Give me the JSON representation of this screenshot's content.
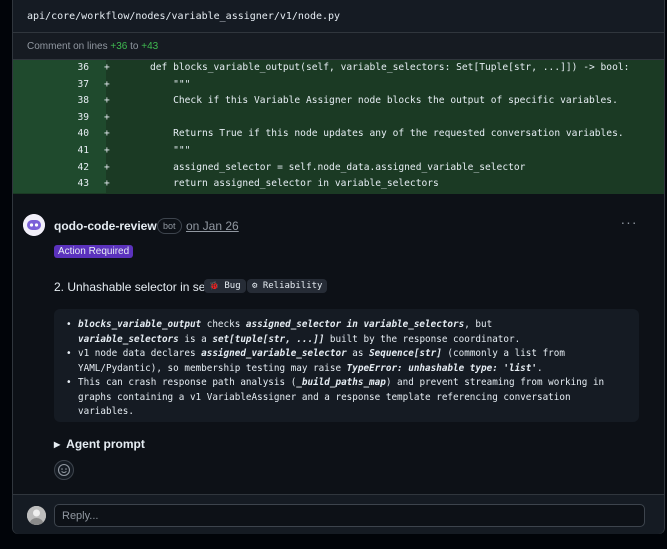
{
  "file": {
    "path": "api/core/workflow/nodes/variable_assigner/v1/node.py"
  },
  "comment_lines": {
    "prefix": "Comment on lines",
    "from": "+36",
    "sep": "to",
    "to": "+43"
  },
  "diff": [
    {
      "num": "36",
      "sign": "+",
      "code": "def blocks_variable_output(self, variable_selectors: Set[Tuple[str, ...]]) -> bool:"
    },
    {
      "num": "37",
      "sign": "+",
      "code": "    \"\"\""
    },
    {
      "num": "38",
      "sign": "+",
      "code": "    Check if this Variable Assigner node blocks the output of specific variables."
    },
    {
      "num": "39",
      "sign": "+",
      "code": ""
    },
    {
      "num": "40",
      "sign": "+",
      "code": "    Returns True if this node updates any of the requested conversation variables."
    },
    {
      "num": "41",
      "sign": "+",
      "code": "    \"\"\""
    },
    {
      "num": "42",
      "sign": "+",
      "code": "    assigned_selector = self.node_data.assigned_variable_selector"
    },
    {
      "num": "43",
      "sign": "+",
      "code": "    return assigned_selector in variable_selectors"
    }
  ],
  "comment": {
    "author": "qodo-code-review",
    "bot_badge": "bot",
    "date": "on Jan 26",
    "more_icon": "kebab-horizontal-icon",
    "action_badge": "Action Required",
    "issue_title": "2. Unhashable selector in set",
    "tags": [
      {
        "icon": "bug-icon",
        "glyph": "🐞",
        "label": "Bug"
      },
      {
        "icon": "gear-icon",
        "glyph": "⚙",
        "label": "Reliability"
      }
    ],
    "bullets": {
      "b1_p1": "blocks_variable_output",
      "b1_p2": " checks ",
      "b1_p3": "assigned_selector in variable_selectors",
      "b1_p4": ", but ",
      "b1_p5": "variable_selectors",
      "b1_p6": " is a ",
      "b1_p7": "set[tuple[str, ...]]",
      "b1_p8": " built by the response coordinator.",
      "b2_p1": "v1 node data declares ",
      "b2_p2": "assigned_variable_selector",
      "b2_p3": " as ",
      "b2_p4": "Sequence[str]",
      "b2_p5": " (commonly a list from YAML/Pydantic), so membership testing may raise ",
      "b2_p6": "TypeError: unhashable type: 'list'",
      "b2_p7": ".",
      "b3_p1": "This can crash response path analysis (",
      "b3_p2": "_build_paths_map",
      "b3_p3": ") and prevent streaming from working in graphs containing a v1 VariableAssigner and a response template referencing conversation variables."
    },
    "agent_prompt": "Agent prompt",
    "emoji_icon": "smiley-icon"
  },
  "reply": {
    "placeholder": "Reply..."
  },
  "colors": {
    "added_bg": "#1b3a24",
    "added_num_bg": "#1f4a2d",
    "accent_green": "#3fb950",
    "badge_purple": "#5b32bd"
  }
}
